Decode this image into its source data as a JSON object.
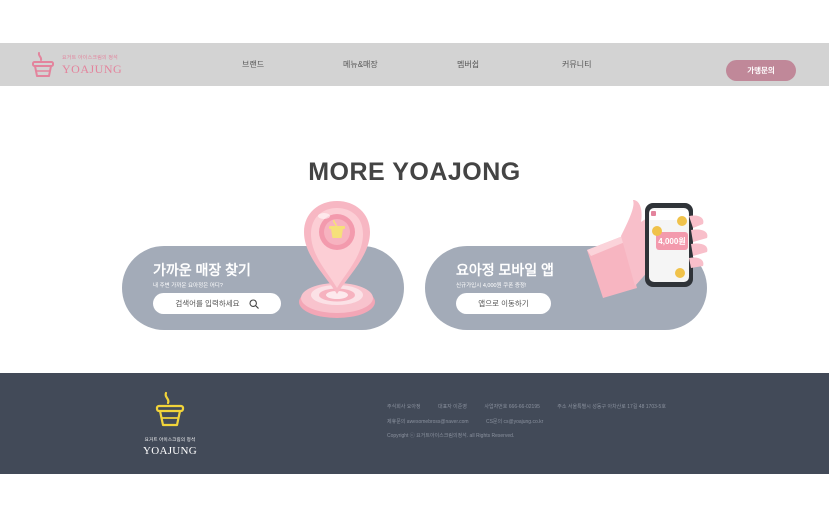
{
  "header": {
    "logo_sub": "요거트 아이스크림의 정석",
    "logo_main": "YOAJUNG",
    "nav": [
      "브랜드",
      "메뉴&매장",
      "멤버쉽",
      "커뮤니티"
    ],
    "franchise_btn": "가맹문의"
  },
  "section": {
    "title": "MORE YOAJONG",
    "store_card": {
      "title": "가까운 매장 찾기",
      "subtitle": "내 주변 가까운 요아정은 어디?",
      "button": "검색어를 입력하세요"
    },
    "app_card": {
      "title": "요아정 모바일 앱",
      "subtitle": "신규가입시 4,000원 쿠폰 증정!",
      "button": "앱으로 이동하기",
      "phone_amount": "4,000원"
    }
  },
  "footer": {
    "logo_sub": "요거트 아이스크림의 정석",
    "logo_main": "YOAJUNG",
    "line1": [
      "주식회사 요아정",
      "대표자 이준영",
      "사업자번호 666-66-02195",
      "주소 서울특별시 성동구 아차산로 17길 48 1703-5호"
    ],
    "line2": [
      "제휴문의 awesomebross@naver.com",
      "CS문의 cs@yoajung.co.kr"
    ],
    "copyright": "Copyright ⓒ 요거트아이스크림의정석. all Rights Reserved."
  },
  "colors": {
    "brand_pink": "#e3849d",
    "button_pink": "#c08899",
    "card_gray": "#a3abb8",
    "footer_bg": "#424a58",
    "footer_yellow": "#f2d43a"
  }
}
